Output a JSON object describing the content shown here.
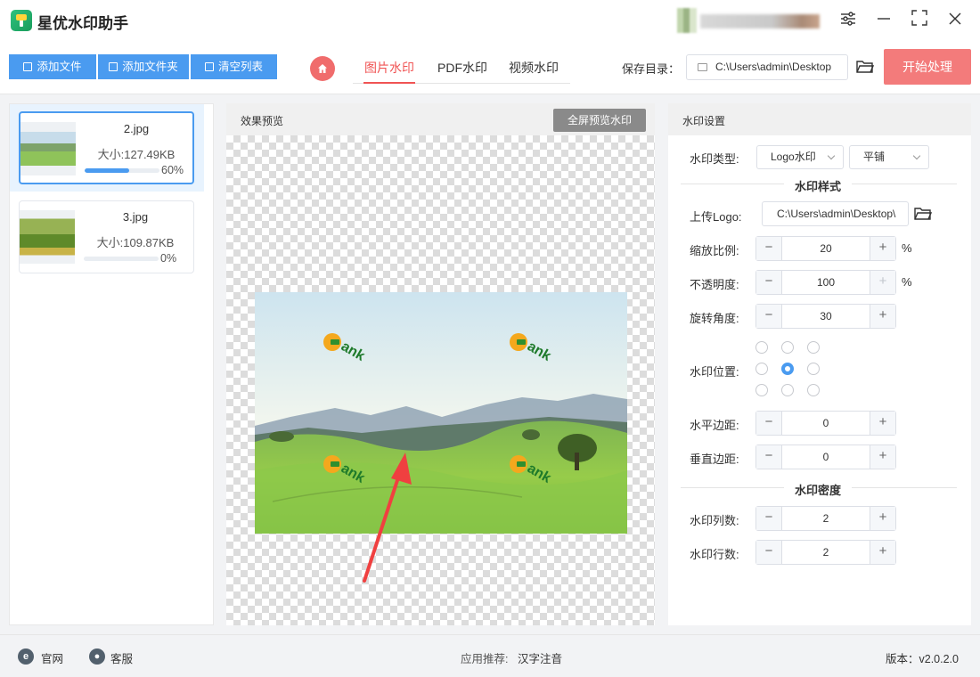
{
  "app": {
    "title": "星优水印助手"
  },
  "toolbar": {
    "add_file": "添加文件",
    "add_folder": "添加文件夹",
    "clear_list": "清空列表",
    "tabs": [
      {
        "label": "图片水印",
        "active": true
      },
      {
        "label": "PDF水印",
        "active": false
      },
      {
        "label": "视频水印",
        "active": false
      }
    ],
    "save_dir_label": "保存目录：",
    "save_dir_value": "C:\\Users\\admin\\Desktop",
    "start_button": "开始处理"
  },
  "files": [
    {
      "name": "2.jpg",
      "size": "大小:127.49KB",
      "progress_label": "60%",
      "progress": 0.6,
      "selected": true
    },
    {
      "name": "3.jpg",
      "size": "大小:109.87KB",
      "progress_label": "0%",
      "progress": 0.0,
      "selected": false
    }
  ],
  "preview": {
    "title": "效果预览",
    "fullscreen_button": "全屏预览水印",
    "watermark_text": "ank"
  },
  "settings": {
    "title": "水印设置",
    "type_label": "水印类型:",
    "type_value": "Logo水印",
    "layout_value": "平铺",
    "style_section": "水印样式",
    "upload_logo_label": "上传Logo:",
    "logo_path": "C:\\Users\\admin\\Desktop\\",
    "scale_label": "缩放比例:",
    "scale_value": "20",
    "scale_unit": "%",
    "opacity_label": "不透明度:",
    "opacity_value": "100",
    "opacity_unit": "%",
    "rotation_label": "旋转角度:",
    "rotation_value": "30",
    "position_label": "水印位置:",
    "position_selected": "center",
    "h_margin_label": "水平边距:",
    "h_margin_value": "0",
    "v_margin_label": "垂直边距:",
    "v_margin_value": "0",
    "density_section": "水印密度",
    "columns_label": "水印列数:",
    "columns_value": "2",
    "rows_label": "水印行数:",
    "rows_value": "2"
  },
  "status": {
    "website": "官网",
    "support": "客服",
    "recommend_label": "应用推荐:",
    "recommend_app": "汉字注音",
    "version": "版本：v2.0.2.0"
  },
  "colors": {
    "accent": "#4a9bf0",
    "danger": "#f37b7b",
    "tab_active": "#f05454"
  }
}
